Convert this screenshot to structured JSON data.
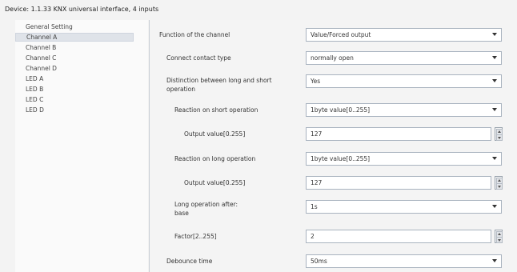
{
  "window": {
    "title": "Device: 1.1.33  KNX universal interface, 4 inputs"
  },
  "sidebar": {
    "items": [
      {
        "label": "General Setting",
        "selected": false
      },
      {
        "label": "Channel A",
        "selected": true
      },
      {
        "label": "Channel B",
        "selected": false
      },
      {
        "label": "Channel C",
        "selected": false
      },
      {
        "label": "Channel D",
        "selected": false
      },
      {
        "label": "LED A",
        "selected": false
      },
      {
        "label": "LED B",
        "selected": false
      },
      {
        "label": "LED C",
        "selected": false
      },
      {
        "label": "LED D",
        "selected": false
      }
    ]
  },
  "params": [
    {
      "label": "Function of the channel",
      "value": "Value/Forced output",
      "control": "dropdown"
    },
    {
      "label": "Connect contact type",
      "value": "normally open",
      "control": "dropdown"
    },
    {
      "label": "Distinction between long and short operation",
      "value": "Yes",
      "control": "dropdown"
    },
    {
      "label": "Reaction on short operation",
      "value": "1byte value[0..255]",
      "control": "dropdown"
    },
    {
      "label": "Output value[0.255]",
      "value": "127",
      "control": "spinner"
    },
    {
      "label": "Reaction on long operation",
      "value": "1byte value[0..255]",
      "control": "dropdown"
    },
    {
      "label": "Output value[0.255]",
      "value": "127",
      "control": "spinner"
    },
    {
      "label": "Long operation after: base",
      "value": "1s",
      "control": "dropdown"
    },
    {
      "label": "Factor[2..255]",
      "value": "2",
      "control": "spinner"
    },
    {
      "label": "Debounce time",
      "value": "50ms",
      "control": "dropdown"
    }
  ]
}
